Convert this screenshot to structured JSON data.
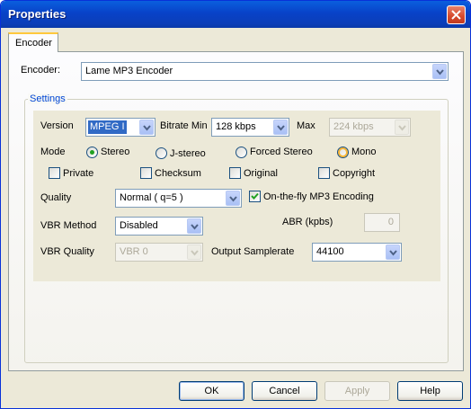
{
  "window": {
    "title": "Properties"
  },
  "tabs": [
    {
      "label": "Encoder"
    }
  ],
  "encoder": {
    "label": "Encoder:",
    "value": "Lame MP3 Encoder"
  },
  "settings": {
    "title": "Settings",
    "version": {
      "label": "Version",
      "value": "MPEG I"
    },
    "bitrate_min": {
      "label": "Bitrate Min",
      "value": "128 kbps"
    },
    "bitrate_max": {
      "label": "Max",
      "value": "224 kbps"
    },
    "mode": {
      "label": "Mode",
      "options": [
        "Stereo",
        "J-stereo",
        "Forced Stereo",
        "Mono"
      ],
      "selected": "Stereo"
    },
    "flags": [
      {
        "label": "Private",
        "checked": false
      },
      {
        "label": "Checksum",
        "checked": false
      },
      {
        "label": "Original",
        "checked": false
      },
      {
        "label": "Copyright",
        "checked": false
      }
    ],
    "quality": {
      "label": "Quality",
      "value": "Normal ( q=5 )"
    },
    "on_the_fly": {
      "label": "On-the-fly MP3 Encoding",
      "checked": true
    },
    "vbr_method": {
      "label": "VBR Method",
      "value": "Disabled"
    },
    "abr": {
      "label": "ABR (kpbs)",
      "value": "0"
    },
    "vbr_quality": {
      "label": "VBR Quality",
      "value": "VBR 0"
    },
    "output_samplerate": {
      "label": "Output Samplerate",
      "value": "44100"
    }
  },
  "buttons": {
    "ok": "OK",
    "cancel": "Cancel",
    "apply": "Apply",
    "help": "Help"
  },
  "colors": {
    "titlebar": "#0a5fde",
    "group_title": "#0046d5",
    "dialog_bg": "#ece9d8"
  }
}
